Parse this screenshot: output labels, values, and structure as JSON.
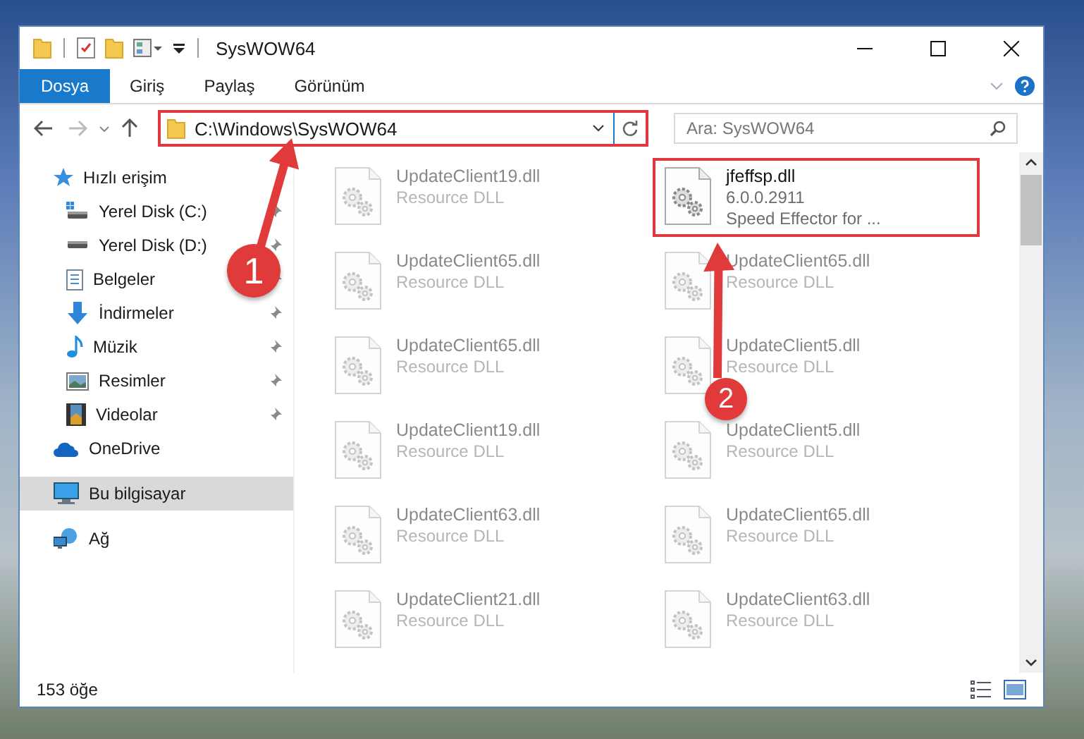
{
  "window": {
    "title": "SysWOW64"
  },
  "ribbon_tabs": [
    {
      "label": "Dosya",
      "selected": true
    },
    {
      "label": "Giriş",
      "selected": false
    },
    {
      "label": "Paylaş",
      "selected": false
    },
    {
      "label": "Görünüm",
      "selected": false
    }
  ],
  "address": {
    "path": "C:\\Windows\\SysWOW64",
    "highlighted": true
  },
  "search": {
    "placeholder": "Ara: SysWOW64"
  },
  "sidebar": {
    "items": [
      {
        "label": "Hızlı erişim",
        "kind": "star",
        "selected": false,
        "children": [
          {
            "label": "Yerel Disk (C:)",
            "kind": "drive-c",
            "pinned": true,
            "selected": false
          },
          {
            "label": "Yerel Disk (D:)",
            "kind": "drive",
            "pinned": true,
            "selected": false
          },
          {
            "label": "Belgeler",
            "kind": "document",
            "pinned": true,
            "selected": false
          },
          {
            "label": "İndirmeler",
            "kind": "download",
            "pinned": true,
            "selected": false
          },
          {
            "label": "Müzik",
            "kind": "music",
            "pinned": true,
            "selected": false
          },
          {
            "label": "Resimler",
            "kind": "picture",
            "pinned": true,
            "selected": false
          },
          {
            "label": "Videolar",
            "kind": "video",
            "pinned": true,
            "selected": false
          }
        ]
      },
      {
        "label": "OneDrive",
        "kind": "cloud",
        "selected": false
      },
      {
        "label": "Bu bilgisayar",
        "kind": "computer",
        "selected": true
      },
      {
        "label": "Ağ",
        "kind": "network",
        "selected": false
      }
    ]
  },
  "files": [
    {
      "name": "UpdateClient19.dll",
      "details": [
        "Resource DLL"
      ],
      "highlighted": false
    },
    {
      "name": "jfeffsp.dll",
      "details": [
        "6.0.0.2911",
        "Speed Effector for ..."
      ],
      "highlighted": true
    },
    {
      "name": "UpdateClient65.dll",
      "details": [
        "Resource DLL"
      ],
      "highlighted": false
    },
    {
      "name": "UpdateClient65.dll",
      "details": [
        "Resource DLL"
      ],
      "highlighted": false
    },
    {
      "name": "UpdateClient65.dll",
      "details": [
        "Resource DLL"
      ],
      "highlighted": false
    },
    {
      "name": "UpdateClient5.dll",
      "details": [
        "Resource DLL"
      ],
      "highlighted": false
    },
    {
      "name": "UpdateClient19.dll",
      "details": [
        "Resource DLL"
      ],
      "highlighted": false
    },
    {
      "name": "UpdateClient5.dll",
      "details": [
        "Resource DLL"
      ],
      "highlighted": false
    },
    {
      "name": "UpdateClient63.dll",
      "details": [
        "Resource DLL"
      ],
      "highlighted": false
    },
    {
      "name": "UpdateClient65.dll",
      "details": [
        "Resource DLL"
      ],
      "highlighted": false
    },
    {
      "name": "UpdateClient21.dll",
      "details": [
        "Resource DLL"
      ],
      "highlighted": false
    },
    {
      "name": "UpdateClient63.dll",
      "details": [
        "Resource DLL"
      ],
      "highlighted": false
    }
  ],
  "status_bar": {
    "item_count": "153 öğe"
  },
  "annotations": [
    {
      "label": "1"
    },
    {
      "label": "2"
    }
  ]
}
